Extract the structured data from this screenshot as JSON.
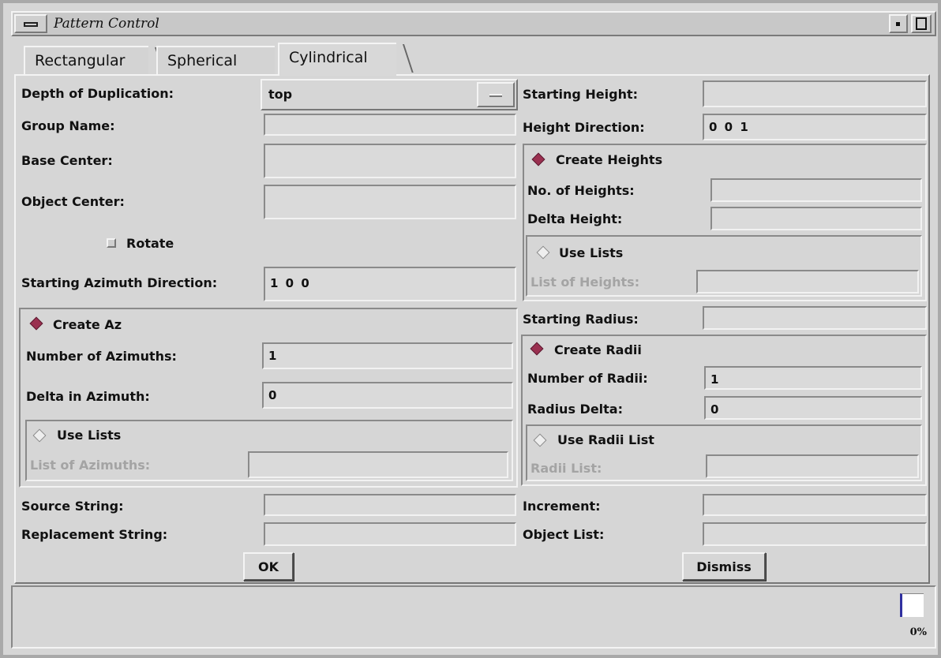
{
  "window": {
    "title": "Pattern Control"
  },
  "tabs": [
    {
      "label": "Rectangular"
    },
    {
      "label": "Spherical"
    },
    {
      "label": "Cylindrical",
      "selected": true
    }
  ],
  "left": {
    "depth_label": "Depth of Duplication:",
    "depth_value": "top",
    "group_name_label": "Group Name:",
    "group_name_value": "",
    "base_center_label": "Base Center:",
    "base_center_value": "",
    "object_center_label": "Object Center:",
    "object_center_value": "",
    "rotate_label": "Rotate",
    "start_az_label": "Starting Azimuth Direction:",
    "start_az_value": "1 0 0",
    "create_az_label": "Create Az",
    "num_az_label": "Number of Azimuths:",
    "num_az_value": "1",
    "delta_az_label": "Delta in Azimuth:",
    "delta_az_value": "0",
    "use_lists_label": "Use Lists",
    "list_az_label": "List of Azimuths:",
    "list_az_value": "",
    "source_label": "Source String:",
    "source_value": "",
    "replacement_label": "Replacement String:",
    "replacement_value": ""
  },
  "right": {
    "start_height_label": "Starting Height:",
    "start_height_value": "",
    "height_dir_label": "Height Direction:",
    "height_dir_value": "0 0 1",
    "create_heights_label": "Create Heights",
    "num_heights_label": "No. of Heights:",
    "num_heights_value": "",
    "delta_height_label": "Delta Height:",
    "delta_height_value": "",
    "use_lists_label": "Use Lists",
    "list_heights_label": "List of Heights:",
    "list_heights_value": "",
    "start_radius_label": "Starting Radius:",
    "start_radius_value": "",
    "create_radii_label": "Create Radii",
    "num_radii_label": "Number of Radii:",
    "num_radii_value": "1",
    "radius_delta_label": "Radius Delta:",
    "radius_delta_value": "0",
    "use_radii_list_label": "Use Radii List",
    "radii_list_label": "Radii List:",
    "radii_list_value": "",
    "increment_label": "Increment:",
    "increment_value": "",
    "object_list_label": "Object List:",
    "object_list_value": ""
  },
  "buttons": {
    "ok": "OK",
    "dismiss": "Dismiss"
  },
  "status": {
    "progress_text": "0%",
    "progress": 0
  }
}
